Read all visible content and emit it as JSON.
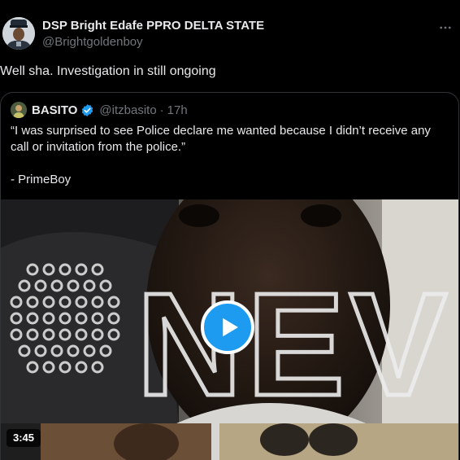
{
  "author": {
    "name": "DSP Bright Edafe PPRO DELTA STATE",
    "handle": "@Brightgoldenboy"
  },
  "more_icon": "ellipsis-icon",
  "tweet": {
    "text": "Well sha. Investigation in still ongoing"
  },
  "quote": {
    "name": "BASITO",
    "verified_icon": "verified-badge-icon",
    "handle": "@itzbasito",
    "separator": "·",
    "time": "17h",
    "lines": [
      "“I was surprised to see Police declare me wanted because I didn’t receive any call or invitation from the police.”",
      "- PrimeBoy"
    ],
    "video": {
      "overlay_text": "NEV",
      "duration": "3:45",
      "play_icon": "play-icon"
    }
  },
  "colors": {
    "background": "#000000",
    "text_primary": "#e7e9ea",
    "text_secondary": "#71767b",
    "border": "#2f3336",
    "accent": "#1d9bf0"
  }
}
